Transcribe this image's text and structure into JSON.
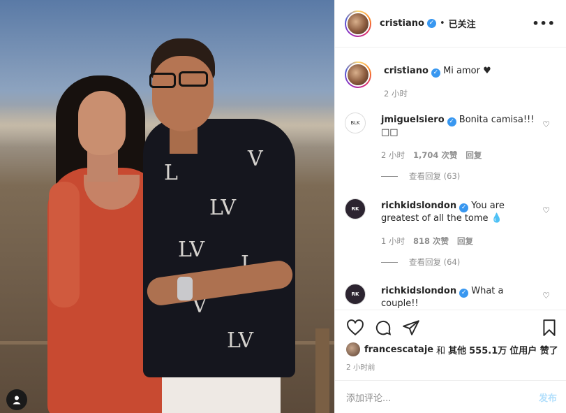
{
  "header": {
    "username": "cristiano",
    "follow_status": "已关注",
    "separator": "•"
  },
  "caption": {
    "username": "cristiano",
    "text": "Mi amor ♥",
    "time": "2 小时"
  },
  "comments": [
    {
      "username": "jmiguelsiero",
      "text": "Bonita camisa!!! □□",
      "time": "2 小时",
      "likes": "1,704 次赞",
      "reply": "回复",
      "view_replies": "查看回复 (63)"
    },
    {
      "username": "richkidslondon",
      "text": "You are greatest of all the tome 💧",
      "time": "1 小时",
      "likes": "818 次赞",
      "reply": "回复",
      "view_replies": "查看回复 (64)"
    },
    {
      "username": "richkidslondon",
      "text": "What a couple!!"
    }
  ],
  "likes": {
    "user": "francescataje",
    "and": "和",
    "others": "其他",
    "count": "555.1万",
    "suffix": "位用户 赞了"
  },
  "post_time": "2 小时前",
  "add_comment": {
    "placeholder": "添加评论...",
    "post_label": "发布"
  },
  "icons": {
    "verified": "verified-badge-icon",
    "heart": "heart-icon",
    "comment": "comment-icon",
    "share": "share-icon",
    "save": "bookmark-icon",
    "more": "more-options-icon",
    "user_tag": "user-tag-icon"
  },
  "colors": {
    "verified": "#3897f0",
    "post_disabled": "#b2dffc"
  }
}
